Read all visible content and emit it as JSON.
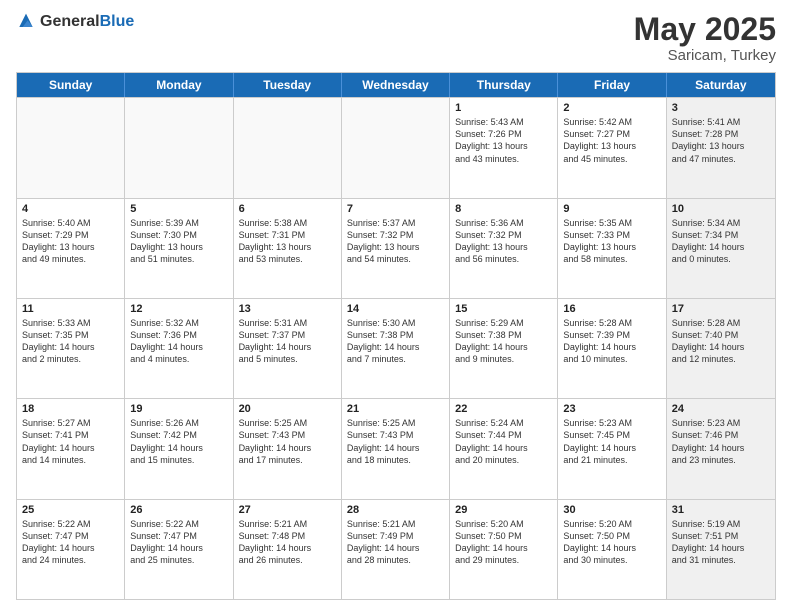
{
  "header": {
    "logo_general": "General",
    "logo_blue": "Blue",
    "title": "May 2025",
    "location": "Saricam, Turkey"
  },
  "weekdays": [
    "Sunday",
    "Monday",
    "Tuesday",
    "Wednesday",
    "Thursday",
    "Friday",
    "Saturday"
  ],
  "rows": [
    [
      {
        "day": "",
        "text": "",
        "empty": true
      },
      {
        "day": "",
        "text": "",
        "empty": true
      },
      {
        "day": "",
        "text": "",
        "empty": true
      },
      {
        "day": "",
        "text": "",
        "empty": true
      },
      {
        "day": "1",
        "text": "Sunrise: 5:43 AM\nSunset: 7:26 PM\nDaylight: 13 hours\nand 43 minutes.",
        "empty": false
      },
      {
        "day": "2",
        "text": "Sunrise: 5:42 AM\nSunset: 7:27 PM\nDaylight: 13 hours\nand 45 minutes.",
        "empty": false
      },
      {
        "day": "3",
        "text": "Sunrise: 5:41 AM\nSunset: 7:28 PM\nDaylight: 13 hours\nand 47 minutes.",
        "empty": false,
        "shaded": true
      }
    ],
    [
      {
        "day": "4",
        "text": "Sunrise: 5:40 AM\nSunset: 7:29 PM\nDaylight: 13 hours\nand 49 minutes.",
        "empty": false
      },
      {
        "day": "5",
        "text": "Sunrise: 5:39 AM\nSunset: 7:30 PM\nDaylight: 13 hours\nand 51 minutes.",
        "empty": false
      },
      {
        "day": "6",
        "text": "Sunrise: 5:38 AM\nSunset: 7:31 PM\nDaylight: 13 hours\nand 53 minutes.",
        "empty": false
      },
      {
        "day": "7",
        "text": "Sunrise: 5:37 AM\nSunset: 7:32 PM\nDaylight: 13 hours\nand 54 minutes.",
        "empty": false
      },
      {
        "day": "8",
        "text": "Sunrise: 5:36 AM\nSunset: 7:32 PM\nDaylight: 13 hours\nand 56 minutes.",
        "empty": false
      },
      {
        "day": "9",
        "text": "Sunrise: 5:35 AM\nSunset: 7:33 PM\nDaylight: 13 hours\nand 58 minutes.",
        "empty": false
      },
      {
        "day": "10",
        "text": "Sunrise: 5:34 AM\nSunset: 7:34 PM\nDaylight: 14 hours\nand 0 minutes.",
        "empty": false,
        "shaded": true
      }
    ],
    [
      {
        "day": "11",
        "text": "Sunrise: 5:33 AM\nSunset: 7:35 PM\nDaylight: 14 hours\nand 2 minutes.",
        "empty": false
      },
      {
        "day": "12",
        "text": "Sunrise: 5:32 AM\nSunset: 7:36 PM\nDaylight: 14 hours\nand 4 minutes.",
        "empty": false
      },
      {
        "day": "13",
        "text": "Sunrise: 5:31 AM\nSunset: 7:37 PM\nDaylight: 14 hours\nand 5 minutes.",
        "empty": false
      },
      {
        "day": "14",
        "text": "Sunrise: 5:30 AM\nSunset: 7:38 PM\nDaylight: 14 hours\nand 7 minutes.",
        "empty": false
      },
      {
        "day": "15",
        "text": "Sunrise: 5:29 AM\nSunset: 7:38 PM\nDaylight: 14 hours\nand 9 minutes.",
        "empty": false
      },
      {
        "day": "16",
        "text": "Sunrise: 5:28 AM\nSunset: 7:39 PM\nDaylight: 14 hours\nand 10 minutes.",
        "empty": false
      },
      {
        "day": "17",
        "text": "Sunrise: 5:28 AM\nSunset: 7:40 PM\nDaylight: 14 hours\nand 12 minutes.",
        "empty": false,
        "shaded": true
      }
    ],
    [
      {
        "day": "18",
        "text": "Sunrise: 5:27 AM\nSunset: 7:41 PM\nDaylight: 14 hours\nand 14 minutes.",
        "empty": false
      },
      {
        "day": "19",
        "text": "Sunrise: 5:26 AM\nSunset: 7:42 PM\nDaylight: 14 hours\nand 15 minutes.",
        "empty": false
      },
      {
        "day": "20",
        "text": "Sunrise: 5:25 AM\nSunset: 7:43 PM\nDaylight: 14 hours\nand 17 minutes.",
        "empty": false
      },
      {
        "day": "21",
        "text": "Sunrise: 5:25 AM\nSunset: 7:43 PM\nDaylight: 14 hours\nand 18 minutes.",
        "empty": false
      },
      {
        "day": "22",
        "text": "Sunrise: 5:24 AM\nSunset: 7:44 PM\nDaylight: 14 hours\nand 20 minutes.",
        "empty": false
      },
      {
        "day": "23",
        "text": "Sunrise: 5:23 AM\nSunset: 7:45 PM\nDaylight: 14 hours\nand 21 minutes.",
        "empty": false
      },
      {
        "day": "24",
        "text": "Sunrise: 5:23 AM\nSunset: 7:46 PM\nDaylight: 14 hours\nand 23 minutes.",
        "empty": false,
        "shaded": true
      }
    ],
    [
      {
        "day": "25",
        "text": "Sunrise: 5:22 AM\nSunset: 7:47 PM\nDaylight: 14 hours\nand 24 minutes.",
        "empty": false
      },
      {
        "day": "26",
        "text": "Sunrise: 5:22 AM\nSunset: 7:47 PM\nDaylight: 14 hours\nand 25 minutes.",
        "empty": false
      },
      {
        "day": "27",
        "text": "Sunrise: 5:21 AM\nSunset: 7:48 PM\nDaylight: 14 hours\nand 26 minutes.",
        "empty": false
      },
      {
        "day": "28",
        "text": "Sunrise: 5:21 AM\nSunset: 7:49 PM\nDaylight: 14 hours\nand 28 minutes.",
        "empty": false
      },
      {
        "day": "29",
        "text": "Sunrise: 5:20 AM\nSunset: 7:50 PM\nDaylight: 14 hours\nand 29 minutes.",
        "empty": false
      },
      {
        "day": "30",
        "text": "Sunrise: 5:20 AM\nSunset: 7:50 PM\nDaylight: 14 hours\nand 30 minutes.",
        "empty": false
      },
      {
        "day": "31",
        "text": "Sunrise: 5:19 AM\nSunset: 7:51 PM\nDaylight: 14 hours\nand 31 minutes.",
        "empty": false,
        "shaded": true
      }
    ]
  ]
}
